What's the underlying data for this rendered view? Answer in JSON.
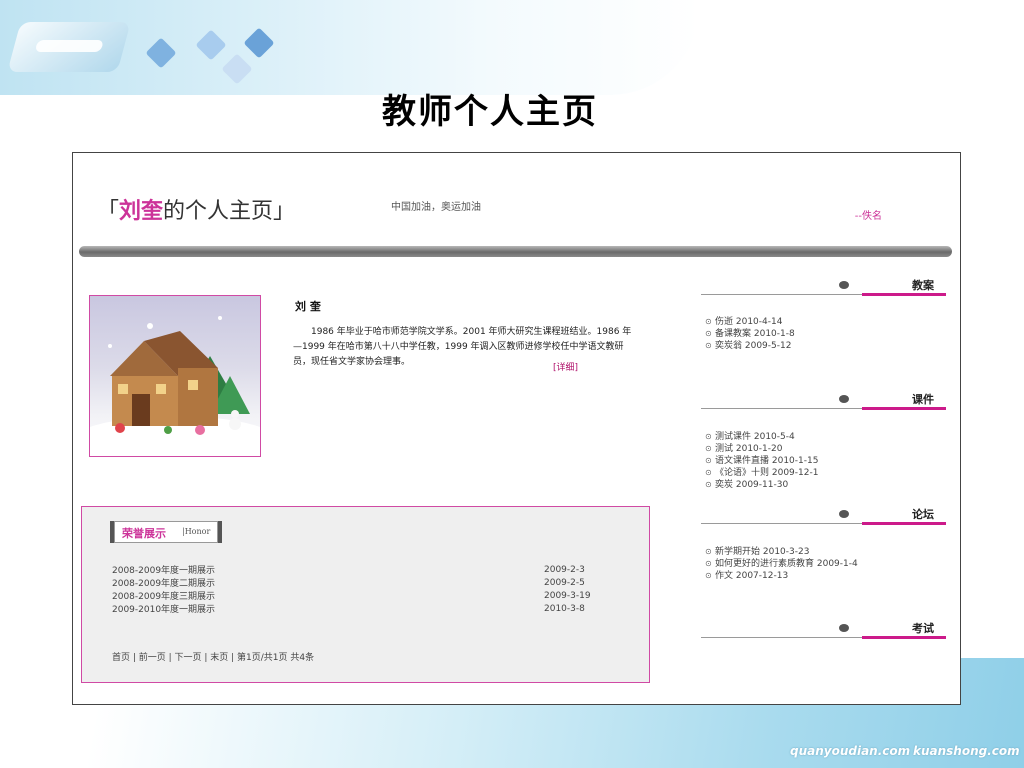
{
  "slide": {
    "title": "教师个人主页",
    "footer_left": "quanyoudian.com",
    "footer_right": "kuanshong.com"
  },
  "page": {
    "site_title_open": "「",
    "site_title_name": "刘奎",
    "site_title_rest": "的个人主页」",
    "slogan": "中国加油，奥运加油",
    "anonymous": "--佚名"
  },
  "profile": {
    "name": "刘 奎",
    "bio": "1986 年毕业于哈市师范学院文学系。2001 年师大研究生课程班结业。1986 年—1999 年在哈市第八十八中学任教，1999 年调入区教师进修学校任中学语文教研员，现任省文学家协会理事。",
    "detail_link": "[详细]"
  },
  "honor": {
    "title": "荣誉展示",
    "subtitle": "|Honor",
    "rows": [
      {
        "text": "2008-2009年度一期展示",
        "date": "2009-2-3"
      },
      {
        "text": "2008-2009年度二期展示",
        "date": "2009-2-5"
      },
      {
        "text": "2008-2009年度三期展示",
        "date": "2009-3-19"
      },
      {
        "text": "2009-2010年度一期展示",
        "date": "2010-3-8"
      }
    ],
    "pager": "首页 | 前一页 | 下一页 | 末页 | 第1页/共1页 共4条"
  },
  "sidebar": {
    "bullet": "⊙",
    "sections": [
      {
        "label": "教案",
        "items": [
          "伤逝 2010-4-14",
          "备课教案 2010-1-8",
          "奕炭翁 2009-5-12"
        ]
      },
      {
        "label": "课件",
        "items": [
          "测试课件 2010-5-4",
          "测试 2010-1-20",
          "语文课件直播 2010-1-15",
          "《论语》十则 2009-12-1",
          "奕炭 2009-11-30"
        ]
      },
      {
        "label": "论坛",
        "items": [
          "新学期开始 2010-3-23",
          "如何更好的进行素质教育 2009-1-4",
          "作文 2007-12-13"
        ]
      },
      {
        "label": "考试",
        "items": []
      }
    ]
  },
  "colors": {
    "accent": "#cc3399",
    "accent_bar": "#cc1a8a",
    "border": "#d04aa4"
  }
}
